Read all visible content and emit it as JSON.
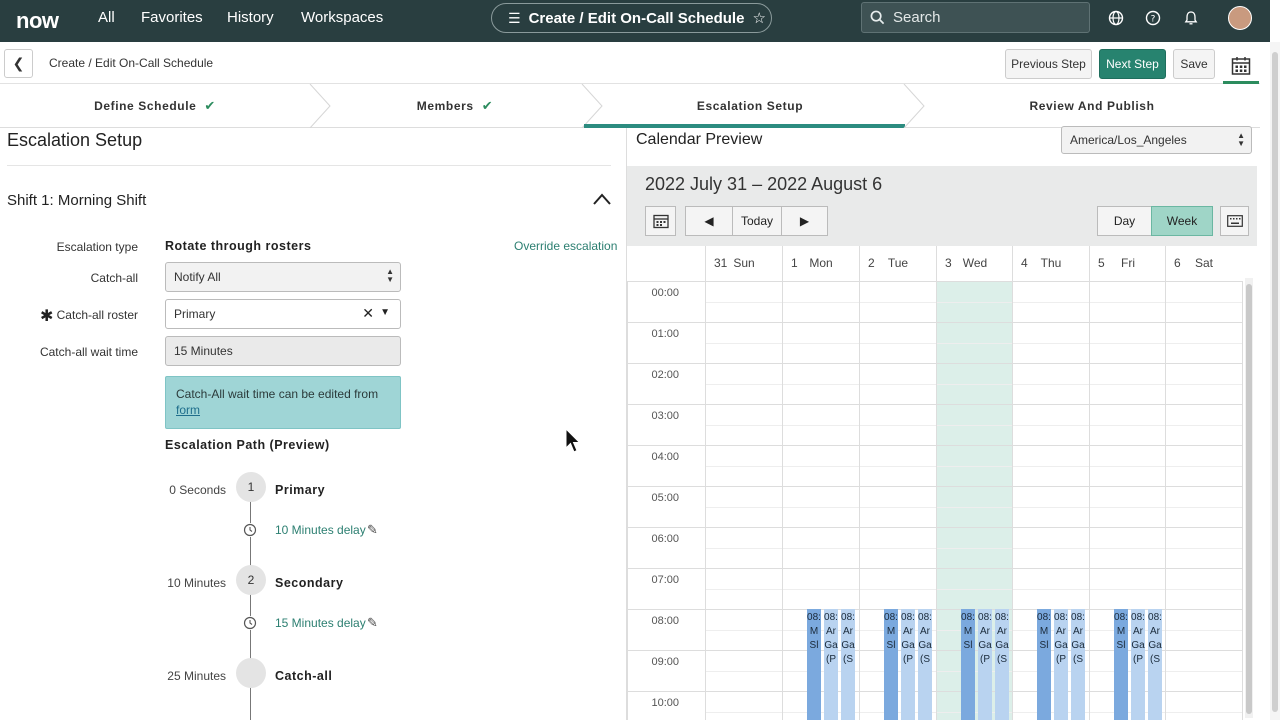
{
  "nav": {
    "logo": "now",
    "links": [
      "All",
      "Favorites",
      "History",
      "Workspaces"
    ],
    "title": "Create / Edit On-Call Schedule",
    "search_placeholder": "Search"
  },
  "header": {
    "breadcrumb": "Create / Edit On-Call Schedule",
    "prev_label": "Previous Step",
    "next_label": "Next Step",
    "save_label": "Save"
  },
  "steps": [
    {
      "label": "Define Schedule",
      "done": true
    },
    {
      "label": "Members",
      "done": true
    },
    {
      "label": "Escalation Setup",
      "done": false,
      "active": true
    },
    {
      "label": "Review And Publish",
      "done": false
    }
  ],
  "escalation": {
    "section_title": "Escalation Setup",
    "shift_title": "Shift 1: Morning Shift",
    "escalation_type_label": "Escalation type",
    "escalation_type_value": "Rotate through rosters",
    "override_label": "Override escalation",
    "catch_all_label": "Catch-all",
    "catch_all_value": "Notify All",
    "catch_all_roster_label": "Catch-all roster",
    "catch_all_roster_value": "Primary",
    "wait_time_label": "Catch-all wait time",
    "wait_time_value": "15 Minutes",
    "info_text": "Catch-All wait time can be edited from",
    "info_link": "form",
    "path_title": "Escalation Path (Preview)",
    "path": [
      {
        "time": "0 Seconds",
        "num": "1",
        "name": "Primary"
      },
      {
        "delay": "10 Minutes delay"
      },
      {
        "time": "10 Minutes",
        "num": "2",
        "name": "Secondary"
      },
      {
        "delay": "15 Minutes delay"
      },
      {
        "time": "25 Minutes",
        "num": "",
        "name": "Catch-all"
      }
    ]
  },
  "calendar": {
    "title": "Calendar Preview",
    "timezone": "America/Los_Angeles",
    "range": "2022 July 31 – 2022 August 6",
    "today_label": "Today",
    "day_label": "Day",
    "week_label": "Week",
    "days": [
      {
        "num": "31",
        "name": "Sun"
      },
      {
        "num": "1",
        "name": "Mon"
      },
      {
        "num": "2",
        "name": "Tue"
      },
      {
        "num": "3",
        "name": "Wed"
      },
      {
        "num": "4",
        "name": "Thu"
      },
      {
        "num": "5",
        "name": "Fri"
      },
      {
        "num": "6",
        "name": "Sat"
      }
    ],
    "hours": [
      "00:00",
      "01:00",
      "02:00",
      "03:00",
      "04:00",
      "05:00",
      "06:00",
      "07:00",
      "08:00",
      "09:00",
      "10:00"
    ],
    "event_lines": [
      [
        "08:",
        "M",
        "Sl"
      ],
      [
        "08:",
        "Ar",
        "Ga",
        "(P"
      ],
      [
        "08:",
        "Ar",
        "Ga",
        "(S"
      ]
    ]
  },
  "colors": {
    "nav_bg": "#293e40",
    "accent": "#27836f",
    "event_primary": "#7ba9de",
    "event_secondary": "#b9d3f0"
  }
}
